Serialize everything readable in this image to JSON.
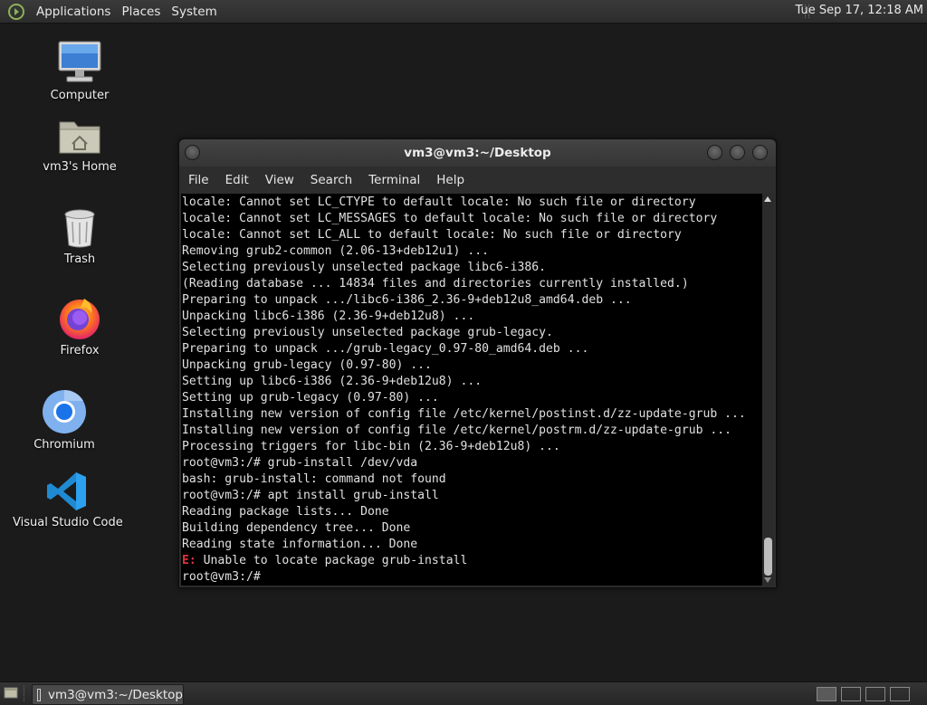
{
  "top_panel": {
    "menus": [
      "Applications",
      "Places",
      "System"
    ],
    "clock": "Tue Sep 17, 12:18 AM"
  },
  "desktop_icons": [
    {
      "label": "Computer",
      "icon": "computer-icon"
    },
    {
      "label": "vm3's Home",
      "icon": "home-folder-icon"
    },
    {
      "label": "Trash",
      "icon": "trash-icon"
    },
    {
      "label": "Firefox",
      "icon": "firefox-icon"
    },
    {
      "label": "Chromium",
      "icon": "chromium-icon"
    },
    {
      "label": "Visual Studio Code",
      "icon": "vscode-icon"
    }
  ],
  "terminal": {
    "title": "vm3@vm3:~/Desktop",
    "menu": [
      "File",
      "Edit",
      "View",
      "Search",
      "Terminal",
      "Help"
    ],
    "lines": [
      "locale: Cannot set LC_CTYPE to default locale: No such file or directory",
      "locale: Cannot set LC_MESSAGES to default locale: No such file or directory",
      "locale: Cannot set LC_ALL to default locale: No such file or directory",
      "Removing grub2-common (2.06-13+deb12u1) ...",
      "Selecting previously unselected package libc6-i386.",
      "(Reading database ... 14834 files and directories currently installed.)",
      "Preparing to unpack .../libc6-i386_2.36-9+deb12u8_amd64.deb ...",
      "Unpacking libc6-i386 (2.36-9+deb12u8) ...",
      "Selecting previously unselected package grub-legacy.",
      "Preparing to unpack .../grub-legacy_0.97-80_amd64.deb ...",
      "Unpacking grub-legacy (0.97-80) ...",
      "Setting up libc6-i386 (2.36-9+deb12u8) ...",
      "Setting up grub-legacy (0.97-80) ...",
      "Installing new version of config file /etc/kernel/postinst.d/zz-update-grub ...",
      "Installing new version of config file /etc/kernel/postrm.d/zz-update-grub ...",
      "Processing triggers for libc-bin (2.36-9+deb12u8) ...",
      "root@vm3:/# grub-install /dev/vda",
      "bash: grub-install: command not found",
      "root@vm3:/# apt install grub-install",
      "Reading package lists... Done",
      "Building dependency tree... Done",
      "Reading state information... Done"
    ],
    "error_prefix": "E:",
    "error_text": " Unable to locate package grub-install",
    "prompt": "root@vm3:/# "
  },
  "taskbar": {
    "task_label": "vm3@vm3:~/Desktop"
  },
  "colors": {
    "desktop_bg": "#1b1b1b",
    "error_red": "#e0323a",
    "terminal_bg": "#000000"
  }
}
